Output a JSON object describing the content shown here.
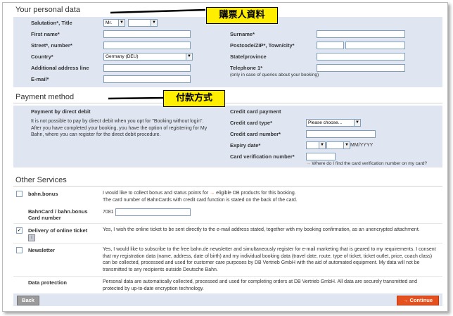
{
  "personal": {
    "title": "Your personal data",
    "callout": "購票人資料",
    "salutation_label": "Salutation*, Title",
    "salutation_value": "Mr.",
    "title_value": "",
    "first_name_label": "First name*",
    "surname_label": "Surname*",
    "street_label": "Street*, number*",
    "postcode_label": "Postcode/ZIP*, Town/city*",
    "country_label": "Country*",
    "country_value": "Germany (DEU)",
    "state_label": "State/province",
    "additional_label": "Additional address line",
    "telephone_label": "Telephone 1*",
    "telephone_note": "(only in case of queries about your booking)",
    "email_label": "E-mail*"
  },
  "payment": {
    "title": "Payment method",
    "callout": "付款方式",
    "debit_title": "Payment by direct debit",
    "debit_text": "It is not possible to pay by direct debit when you opt for \"Booking without login\". After you have completed your booking, you have the option of registering for My Bahn, where you can register for the direct debit procedure.",
    "credit_title": "Credit card payment",
    "card_type_label": "Credit card type*",
    "card_type_value": "Please choose...",
    "card_number_label": "Credit card number*",
    "expiry_label": "Expiry date*",
    "expiry_format": "MM/YYYY",
    "cvn_label": "Card verification number*",
    "cvn_help": "Where do I find the card verification number on my card?"
  },
  "other": {
    "title": "Other Services",
    "bonus_label": "bahn.bonus",
    "bonus_text_pre": "I would like to collect bonus and status points for ",
    "bonus_text_link": "eligible DB products for this booking.",
    "bonus_text2": "The card number of BahnCards with credit card function is stated on the back of the card.",
    "bahncard_label": "BahnCard / bahn.bonus Card number",
    "bahncard_prefix": "7081",
    "delivery_label": "Delivery of online ticket",
    "delivery_text": "Yes, I wish the online ticket to be sent directly to the e-mail address stated, together with my booking confirmation, as an unencrypted attachment.",
    "newsletter_label": "Newsletter",
    "newsletter_text": "Yes, I would like to subscribe to the free bahn.de newsletter and simultaneously register for e-mail marketing that is geared to my requirements. I consent that my registration data (name, address, date of birth) and my individual booking data (travel date, route, type of ticket, ticket outlet, price, coach class) can be collected, processed and used for customer care purposes by DB Vertrieb GmbH with the aid of automated equipment. My data will not be transmitted to any recipients outside Deutsche Bahn.",
    "protection_label": "Data protection",
    "protection_text": "Personal data are automatically collected, processed and used for completing orders at DB Vertrieb GmbH. All data are securely transmitted and protected by up-to-date encryption technology."
  },
  "nav": {
    "back_label": "Back",
    "continue_label": "Continue"
  }
}
